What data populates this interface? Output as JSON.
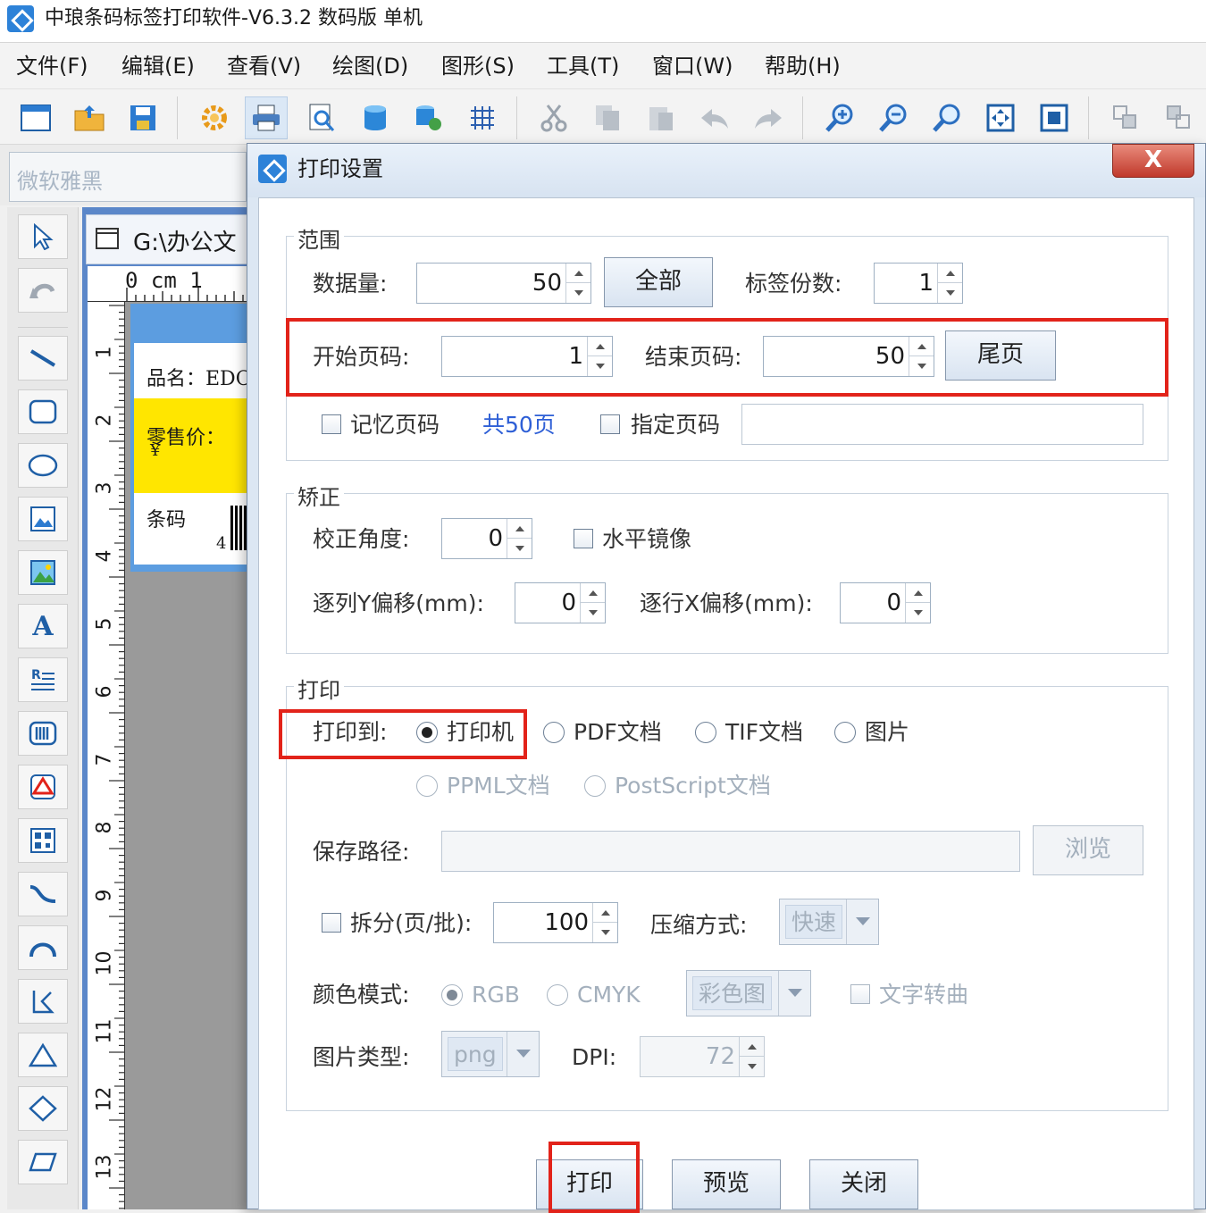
{
  "app": {
    "title": "中琅条码标签打印软件-V6.3.2 数码版 单机"
  },
  "menu": [
    {
      "label": "文件(F)"
    },
    {
      "label": "编辑(E)"
    },
    {
      "label": "查看(V)"
    },
    {
      "label": "绘图(D)"
    },
    {
      "label": "图形(S)"
    },
    {
      "label": "工具(T)"
    },
    {
      "label": "窗口(W)"
    },
    {
      "label": "帮助(H)"
    }
  ],
  "toolbar": {
    "icons": [
      "new-icon",
      "open-icon",
      "save-icon",
      "settings-icon",
      "print-icon",
      "print-preview-icon",
      "database-icon",
      "database-settings-icon",
      "grid-icon",
      "cut-icon",
      "copy-icon",
      "paste-icon",
      "undo-icon",
      "redo-icon",
      "zoom-in-icon",
      "zoom-out-icon",
      "zoom-icon",
      "fit-page-icon",
      "actual-size-icon",
      "bring-front-icon",
      "send-back-icon"
    ],
    "active": "print-icon"
  },
  "font_box": {
    "value": "微软雅黑"
  },
  "document": {
    "tab_title": "G:\\办公文",
    "ruler_label": "0 cm 1",
    "ruler_numbers": [
      "1",
      "2",
      "3",
      "4",
      "5",
      "6",
      "7",
      "8",
      "9",
      "10",
      "11",
      "12",
      "13"
    ],
    "label_lines": {
      "name": "品名：EDC",
      "price": "零售价：",
      "currency": "¥",
      "barcode_label": "条码",
      "barcode_digit": "4"
    }
  },
  "dialog": {
    "title": "打印设置",
    "close_label": "X",
    "range": {
      "title": "范围",
      "data_count_label": "数据量:",
      "data_count": "50",
      "all_button": "全部",
      "copies_label": "标签份数:",
      "copies": "1",
      "start_page_label": "开始页码:",
      "start_page": "1",
      "end_page_label": "结束页码:",
      "end_page": "50",
      "last_page_button": "尾页",
      "remember_page_label": "记忆页码",
      "remember_page_checked": false,
      "total_pages": "共50页",
      "specify_page_label": "指定页码",
      "specify_page_checked": false,
      "specify_page_value": ""
    },
    "correction": {
      "title": "矫正",
      "angle_label": "校正角度:",
      "angle": "0",
      "mirror_label": "水平镜像",
      "mirror_checked": false,
      "col_y_offset_label": "逐列Y偏移(mm):",
      "col_y_offset": "0",
      "row_x_offset_label": "逐行X偏移(mm):",
      "row_x_offset": "0"
    },
    "print": {
      "title": "打印",
      "print_to_label": "打印到:",
      "targets": [
        {
          "label": "打印机",
          "checked": true,
          "enabled": true
        },
        {
          "label": "PDF文档",
          "checked": false,
          "enabled": true
        },
        {
          "label": "TIF文档",
          "checked": false,
          "enabled": true
        },
        {
          "label": "图片",
          "checked": false,
          "enabled": true
        },
        {
          "label": "PPML文档",
          "checked": false,
          "enabled": false
        },
        {
          "label": "PostScript文档",
          "checked": false,
          "enabled": false
        }
      ],
      "save_path_label": "保存路径:",
      "save_path": "",
      "browse_button": "浏览",
      "split_label": "拆分(页/批):",
      "split_checked": false,
      "split_value": "100",
      "compression_label": "压缩方式:",
      "compression_value": "快速",
      "color_mode_label": "颜色模式:",
      "color_modes": [
        {
          "label": "RGB",
          "checked": true
        },
        {
          "label": "CMYK",
          "checked": false
        }
      ],
      "color_type_value": "彩色图",
      "text_to_curve_label": "文字转曲",
      "text_to_curve_checked": false,
      "image_type_label": "图片类型:",
      "image_type_value": "png",
      "dpi_label": "DPI:",
      "dpi_value": "72"
    },
    "buttons": {
      "print": "打印",
      "preview": "预览",
      "close": "关闭"
    }
  },
  "colors": {
    "highlight": "#e2231a",
    "link_blue": "#2e5fd6",
    "label_yellow": "#ffe600"
  }
}
